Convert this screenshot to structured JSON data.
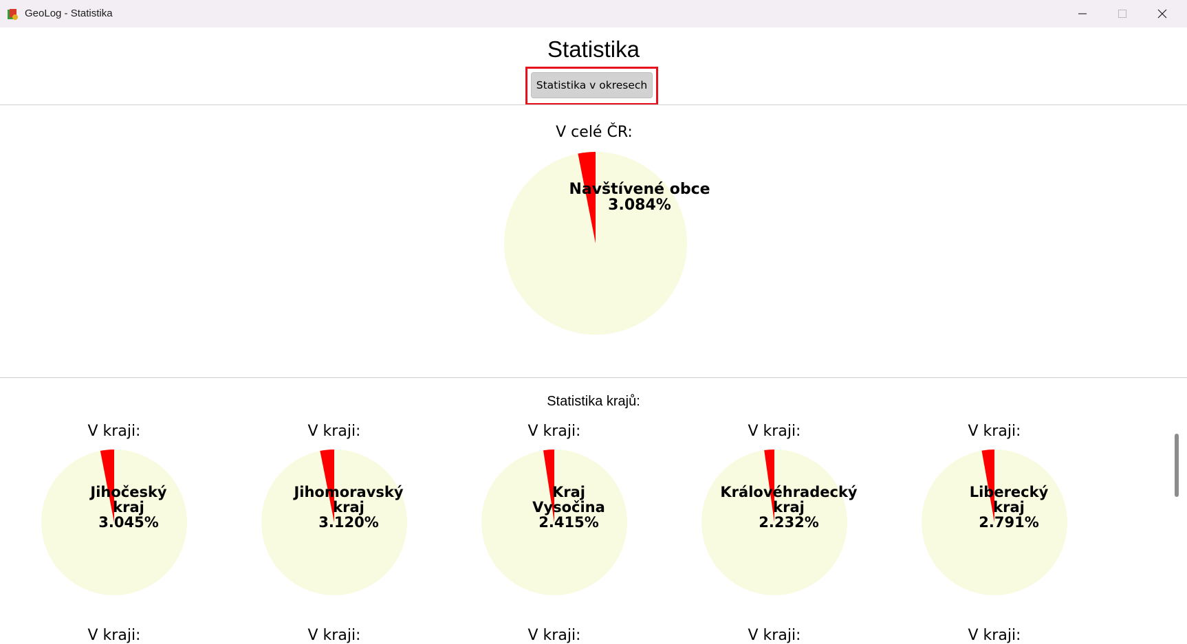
{
  "window": {
    "title": "GeoLog - Statistika",
    "icon": "geolog-app-icon",
    "controls": [
      "minimize-icon",
      "maximize-icon",
      "close-icon"
    ]
  },
  "header": {
    "title": "Statistika",
    "district_button_label": "Statistika v okresech"
  },
  "country": {
    "label": "V celé ČR:",
    "slice_label": "Navštívené obce",
    "percent": 3.084,
    "percent_text": "3.084%"
  },
  "regions_title": "Statistika krajů:",
  "colors": {
    "visited": "#ff0000",
    "unvisited": "#f8fbdf",
    "highlight_frame": "#e8101c",
    "button_bg": "#d2d2d2"
  },
  "regions": [
    {
      "label": "V kraji:",
      "name": "Jihočeský\nkraj",
      "percent": 3.045,
      "percent_text": "3.045%"
    },
    {
      "label": "V kraji:",
      "name": "Jihomoravský\nkraj",
      "percent": 3.12,
      "percent_text": "3.120%"
    },
    {
      "label": "V kraji:",
      "name": "Kraj\nVysočina",
      "percent": 2.415,
      "percent_text": "2.415%"
    },
    {
      "label": "V kraji:",
      "name": "Královéhradecký\nkraj",
      "percent": 2.232,
      "percent_text": "2.232%"
    },
    {
      "label": "V kraji:",
      "name": "Liberecký\nkraj",
      "percent": 2.791,
      "percent_text": "2.791%"
    }
  ],
  "next_row_label": "V kraji:"
}
